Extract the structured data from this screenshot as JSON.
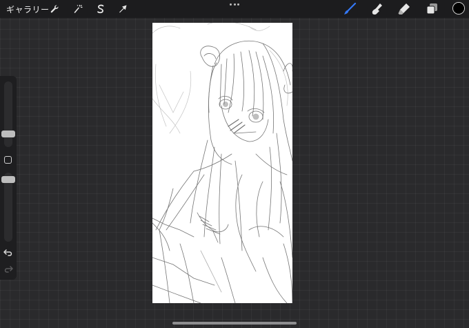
{
  "topbar": {
    "gallery_label": "ギャラリー",
    "left_tools": [
      {
        "name": "actions",
        "icon": "wrench-icon"
      },
      {
        "name": "adjustments",
        "icon": "magic-wand-icon"
      },
      {
        "name": "selection",
        "icon": "selection-s-icon"
      },
      {
        "name": "transform",
        "icon": "arrow-cursor-icon"
      }
    ],
    "right_tools": [
      {
        "name": "brush",
        "icon": "brush-icon",
        "active": true
      },
      {
        "name": "smudge",
        "icon": "smudge-finger-icon"
      },
      {
        "name": "eraser",
        "icon": "eraser-icon"
      },
      {
        "name": "layers",
        "icon": "layers-icon"
      }
    ],
    "current_color": "#000000",
    "accent_color": "#3478f6"
  },
  "sidebar": {
    "brush_size_level": 0.3,
    "opacity_level": 0.55,
    "modify_icon": "square-icon",
    "undo_icon": "undo-icon",
    "redo_icon": "redo-icon"
  },
  "canvas": {
    "background": "#ffffff",
    "content": "pencil-sketch-artwork"
  }
}
